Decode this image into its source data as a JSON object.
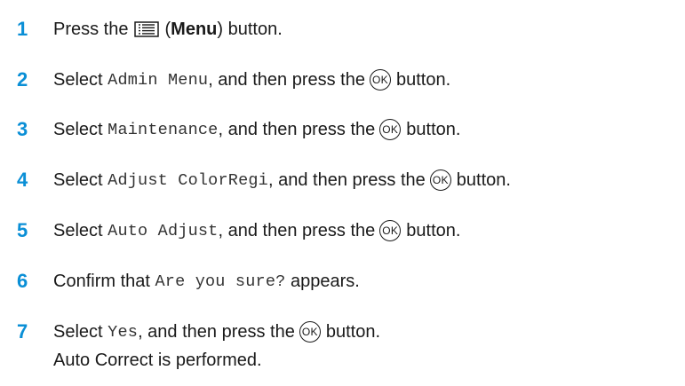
{
  "steps": [
    {
      "number": "1",
      "prefix": "Press the",
      "open_paren": "(",
      "menu_label": "Menu",
      "close_suffix": ") button.",
      "icon": "menu-icon"
    },
    {
      "number": "2",
      "select": "Select",
      "code": "Admin Menu",
      "middle": ", and then press the",
      "ok": "OK",
      "end": "button."
    },
    {
      "number": "3",
      "select": "Select",
      "code": "Maintenance",
      "middle": ", and then press the",
      "ok": "OK",
      "end": "button."
    },
    {
      "number": "4",
      "select": "Select",
      "code": "Adjust ColorRegi",
      "middle": ", and then press the",
      "ok": "OK",
      "end": "button."
    },
    {
      "number": "5",
      "select": "Select",
      "code": "Auto Adjust",
      "middle": ", and then press the",
      "ok": "OK",
      "end": "button."
    },
    {
      "number": "6",
      "prefix": "Confirm that",
      "code": "Are you sure?",
      "end": "appears."
    },
    {
      "number": "7",
      "select": "Select",
      "code": "Yes",
      "middle": ", and then press the",
      "ok": "OK",
      "end": "button."
    }
  ],
  "result_text": "Auto Correct is performed.",
  "colors": {
    "step_number": "#0a8fd6",
    "text": "#1a1a1a"
  }
}
